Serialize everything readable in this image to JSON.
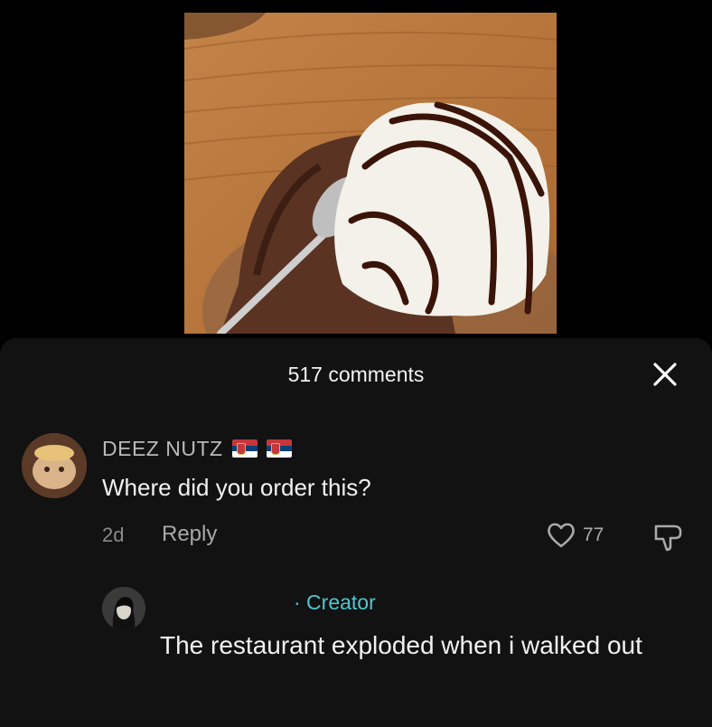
{
  "video": {
    "description_icon": "food-photo"
  },
  "comments_header": {
    "count_label": "517 comments",
    "close_icon": "close-icon"
  },
  "comment": {
    "username": "DEEZ NUTZ",
    "flags": [
      "serbia-flag-icon",
      "serbia-flag-icon"
    ],
    "text": "Where did you order this?",
    "time": "2d",
    "reply_label": "Reply",
    "likes": "77"
  },
  "reply": {
    "creator_label": "· Creator",
    "text": "The restaurant exploded when i walked out"
  },
  "colors": {
    "sheet_bg": "#121212",
    "creator_accent": "#4fc6cf"
  }
}
